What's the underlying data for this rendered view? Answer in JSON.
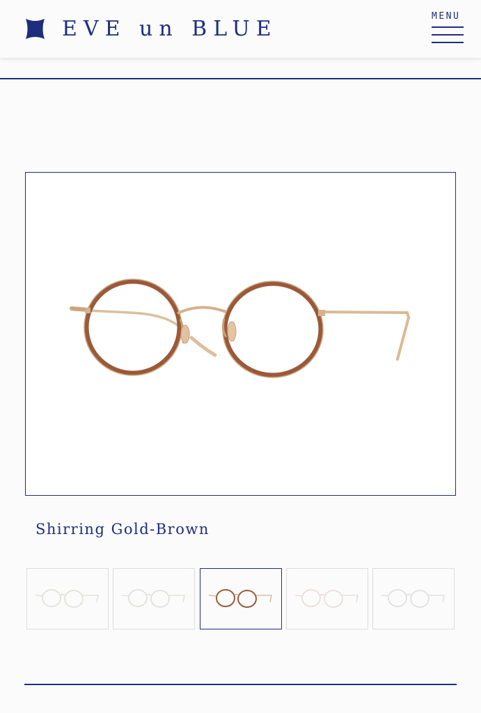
{
  "header": {
    "brand": "EVE un BLUE",
    "menu_label": "MENU"
  },
  "colors": {
    "brand_navy": "#1e2d7d",
    "frame_gold": "#d9b894",
    "rim_brown": "#9a5a3a"
  },
  "icons": {
    "logo": "logo-mark-icon",
    "menu": "hamburger-icon"
  },
  "product": {
    "name": "Shirring Gold-Brown"
  },
  "gallery": {
    "variants": [
      "variant-1",
      "variant-2",
      "variant-3",
      "variant-4",
      "variant-5"
    ],
    "selected_index": 2
  }
}
